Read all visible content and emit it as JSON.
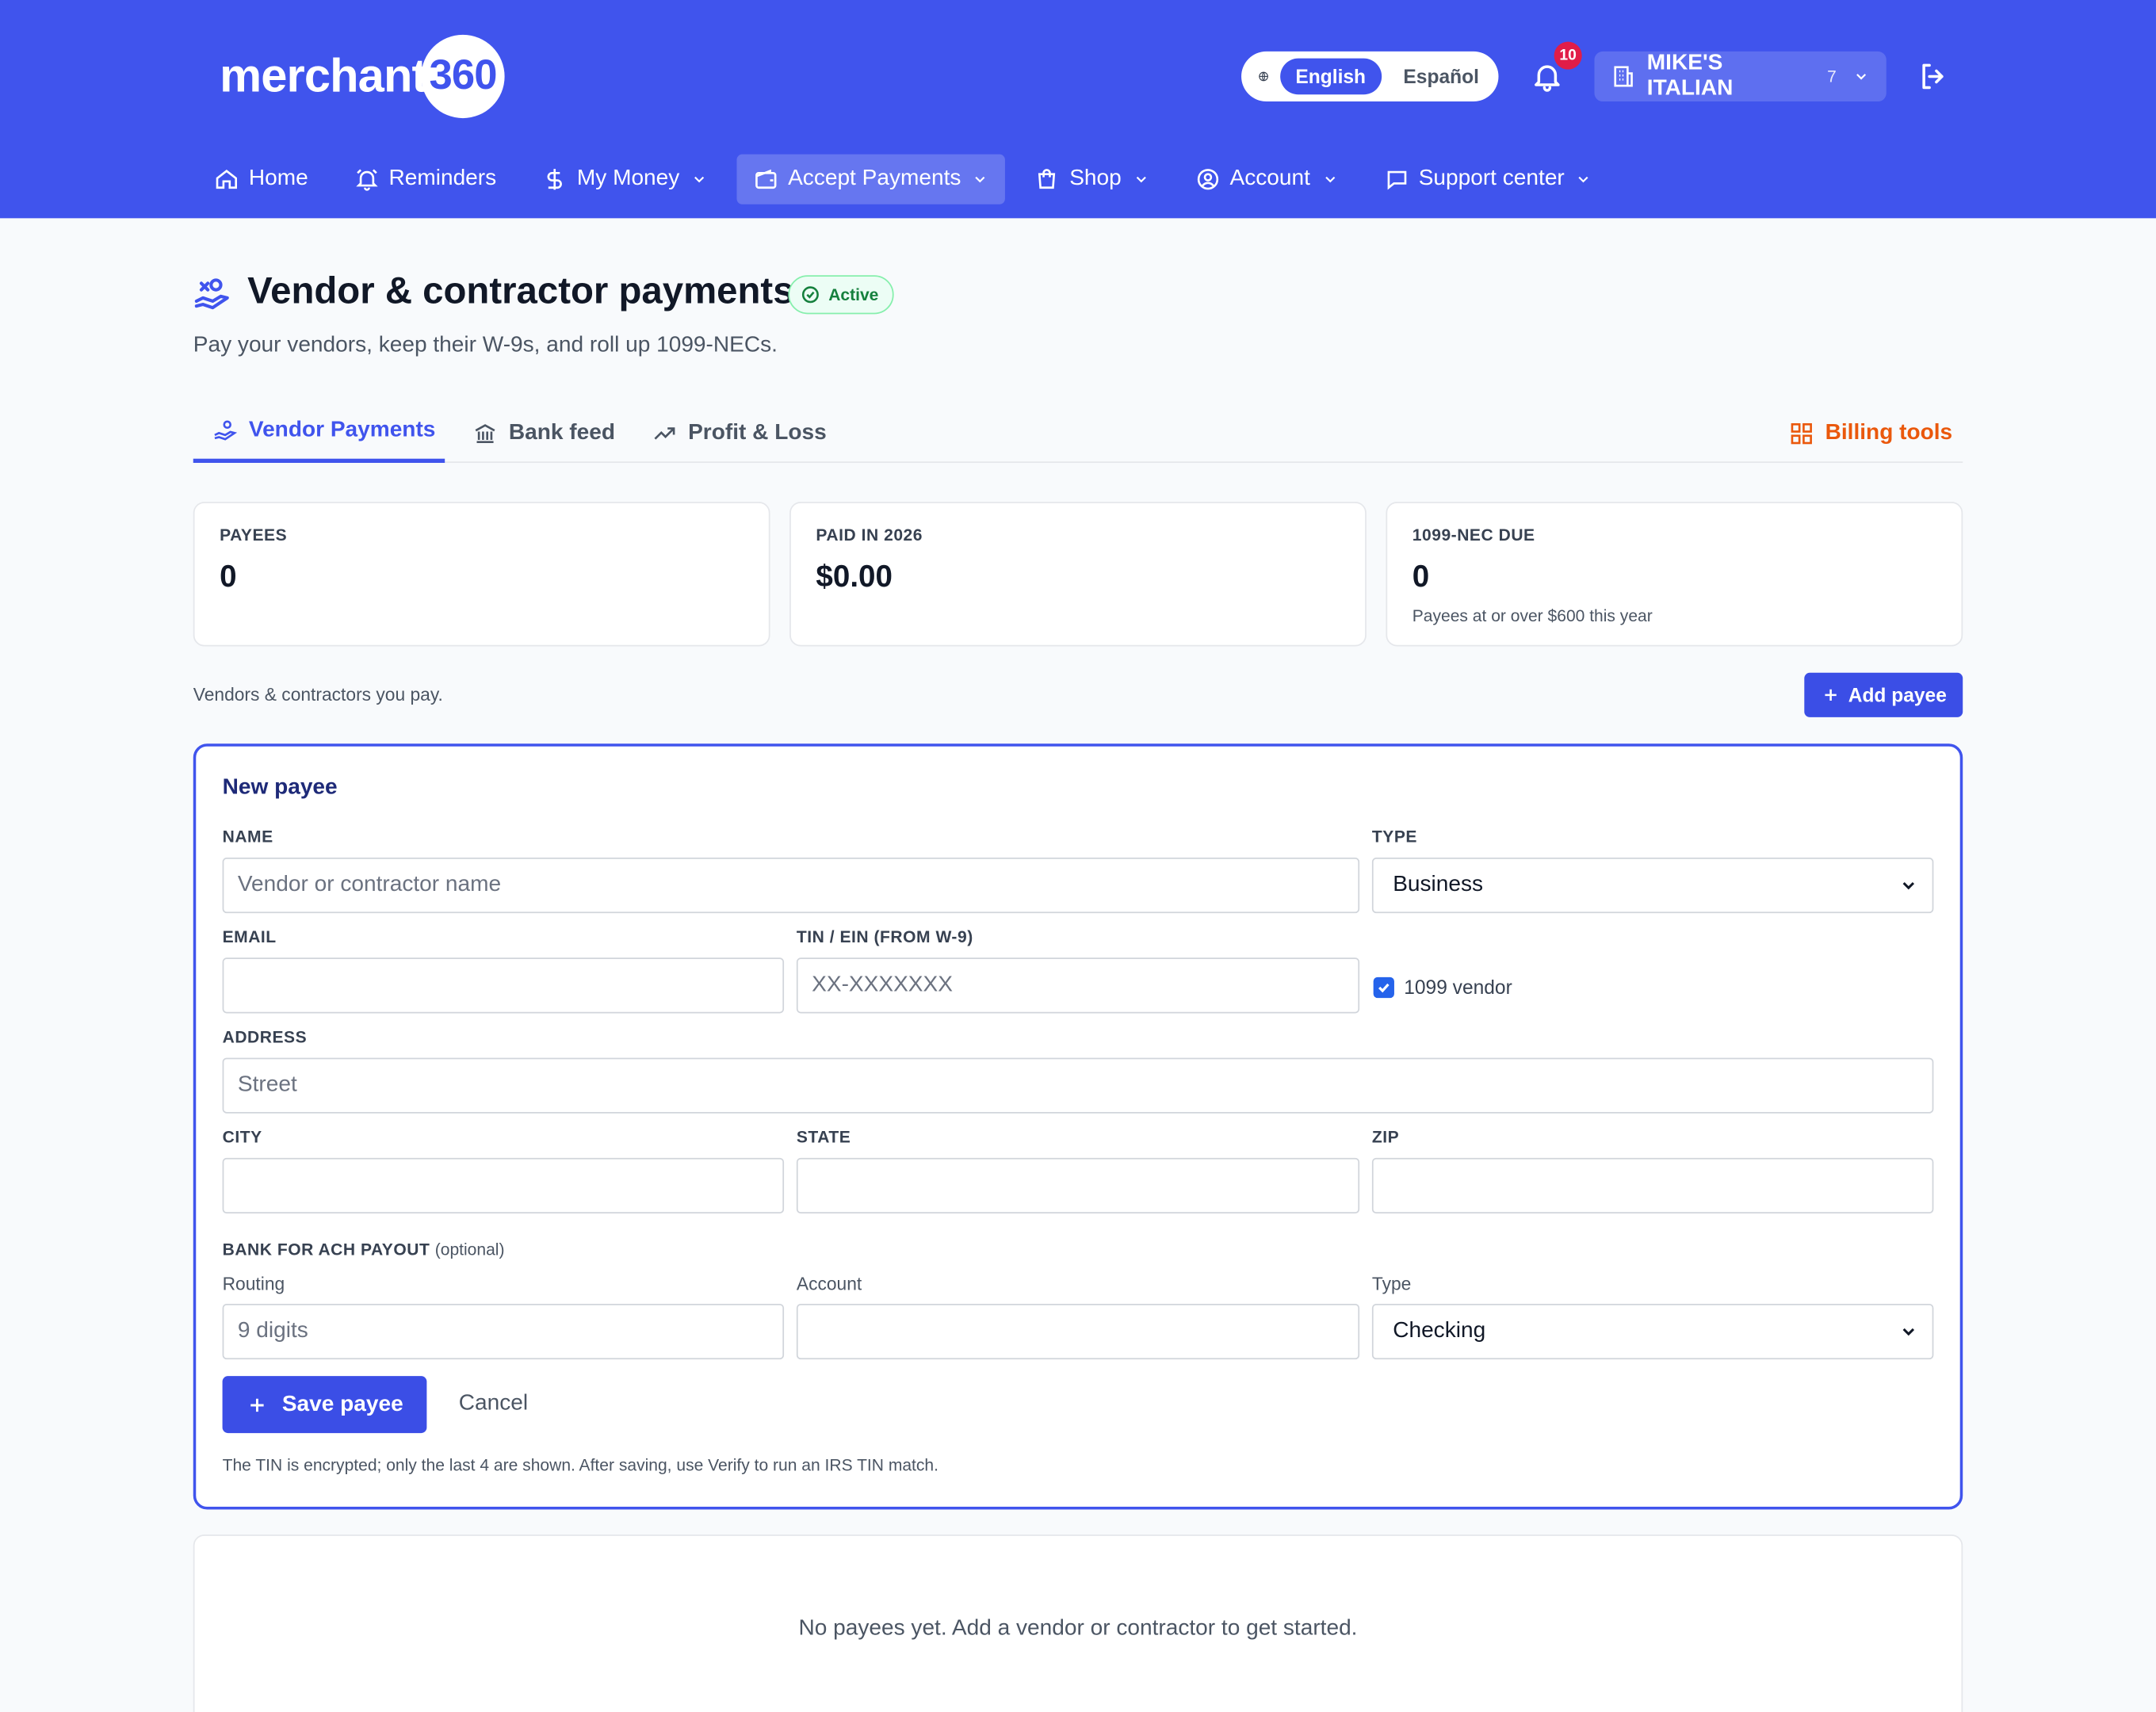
{
  "brand": {
    "logo_text": "merchant",
    "logo_number": "360"
  },
  "header": {
    "languages": [
      "English",
      "Español"
    ],
    "notifications_count": "10",
    "business_name": "MIKE'S ITALIAN",
    "business_count": "7"
  },
  "nav": {
    "items": [
      {
        "label": "Home"
      },
      {
        "label": "Reminders"
      },
      {
        "label": "My Money"
      },
      {
        "label": "Accept Payments"
      },
      {
        "label": "Shop"
      },
      {
        "label": "Account"
      },
      {
        "label": "Support center"
      }
    ]
  },
  "page": {
    "title": "Vendor & contractor payments",
    "status": "Active",
    "subtitle": "Pay your vendors, keep their W-9s, and roll up 1099-NECs."
  },
  "tabs": {
    "items": [
      {
        "label": "Vendor Payments"
      },
      {
        "label": "Bank feed"
      },
      {
        "label": "Profit & Loss"
      }
    ],
    "billing_label": "Billing tools"
  },
  "stats": [
    {
      "label": "PAYEES",
      "value": "0",
      "sub": ""
    },
    {
      "label": "PAID IN 2026",
      "value": "$0.00",
      "sub": ""
    },
    {
      "label": "1099-NEC DUE",
      "value": "0",
      "sub": "Payees at or over $600 this year"
    }
  ],
  "list": {
    "description": "Vendors & contractors you pay.",
    "add_label": "Add payee",
    "empty_text": "No payees yet. Add a vendor or contractor to get started."
  },
  "form": {
    "title": "New payee",
    "name_label": "NAME",
    "name_placeholder": "Vendor or contractor name",
    "type_label": "TYPE",
    "type_value": "Business",
    "email_label": "EMAIL",
    "tin_label": "TIN / EIN (FROM W-9)",
    "tin_placeholder": "XX-XXXXXXX",
    "vendor_1099_label": "1099 vendor",
    "vendor_1099_checked": true,
    "address_label": "ADDRESS",
    "street_placeholder": "Street",
    "city_label": "CITY",
    "state_label": "STATE",
    "zip_label": "ZIP",
    "bank_label": "BANK FOR ACH PAYOUT",
    "bank_optional": "(optional)",
    "routing_label": "Routing",
    "routing_placeholder": "9 digits",
    "account_label": "Account",
    "acct_type_label": "Type",
    "acct_type_value": "Checking",
    "save_label": "Save payee",
    "cancel_label": "Cancel",
    "note": "The TIN is encrypted; only the last 4 are shown. After saving, use Verify to run an IRS TIN match."
  },
  "colors": {
    "header_bg": "#4054ed",
    "primary": "#3b4ee6",
    "billing_accent": "#ea580c",
    "status_green": "#15803d",
    "badge_red": "#e11d48"
  }
}
